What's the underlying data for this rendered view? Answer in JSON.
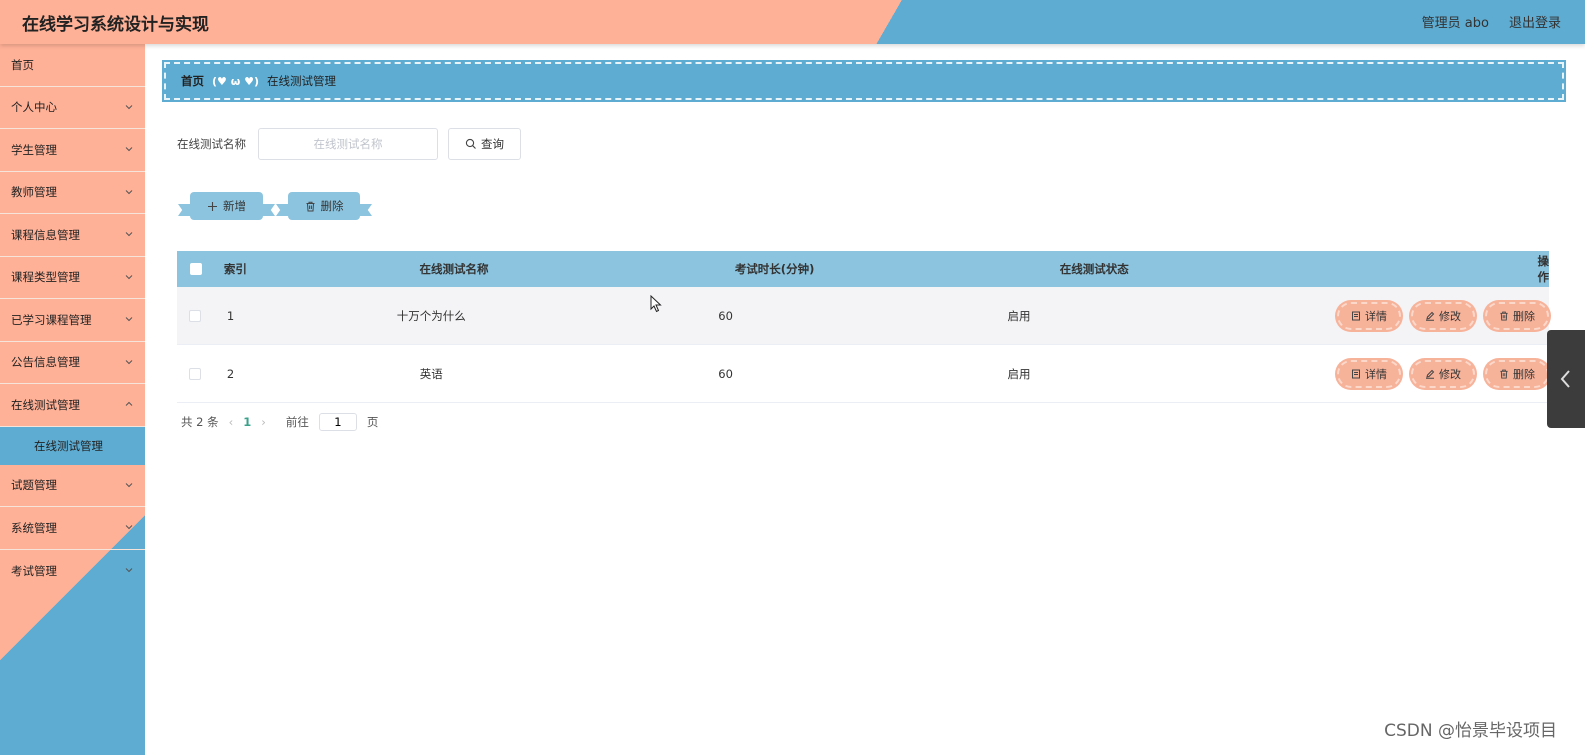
{
  "header": {
    "title": "在线学习系统设计与实现",
    "user": "管理员 abo",
    "logout": "退出登录"
  },
  "sidebar": {
    "items": [
      {
        "label": "首页",
        "expandable": false
      },
      {
        "label": "个人中心",
        "expandable": true
      },
      {
        "label": "学生管理",
        "expandable": true
      },
      {
        "label": "教师管理",
        "expandable": true
      },
      {
        "label": "课程信息管理",
        "expandable": true
      },
      {
        "label": "课程类型管理",
        "expandable": true
      },
      {
        "label": "已学习课程管理",
        "expandable": true
      },
      {
        "label": "公告信息管理",
        "expandable": true
      },
      {
        "label": "在线测试管理",
        "expandable": true,
        "expanded": true
      },
      {
        "label": "试题管理",
        "expandable": true
      },
      {
        "label": "系统管理",
        "expandable": true
      },
      {
        "label": "考试管理",
        "expandable": true
      }
    ],
    "submenu_active": "在线测试管理"
  },
  "breadcrumb": {
    "home": "首页",
    "separator": "(♥ ω ♥)",
    "current": "在线测试管理"
  },
  "search": {
    "label": "在线测试名称",
    "placeholder": "在线测试名称",
    "value": "",
    "button": "查询"
  },
  "actions": {
    "add": "新增",
    "delete": "删除"
  },
  "table": {
    "headers": {
      "index": "索引",
      "name": "在线测试名称",
      "duration": "考试时长(分钟)",
      "status": "在线测试状态",
      "ops": "操作"
    },
    "rows": [
      {
        "index": "1",
        "name": "十万个为什么",
        "duration": "60",
        "status": "启用"
      },
      {
        "index": "2",
        "name": "英语",
        "duration": "60",
        "status": "启用"
      }
    ],
    "op_labels": {
      "detail": "详情",
      "edit": "修改",
      "delete": "删除"
    }
  },
  "pagination": {
    "total": "共 2 条",
    "current_page": "1",
    "goto_prefix": "前往",
    "goto_value": "1",
    "goto_suffix": "页"
  },
  "watermark": "CSDN @怡景毕设项目",
  "colors": {
    "salmon": "#ffb197",
    "blue": "#5eacd2",
    "table_header": "#8cc4df",
    "op_button": "#f7b29a"
  }
}
